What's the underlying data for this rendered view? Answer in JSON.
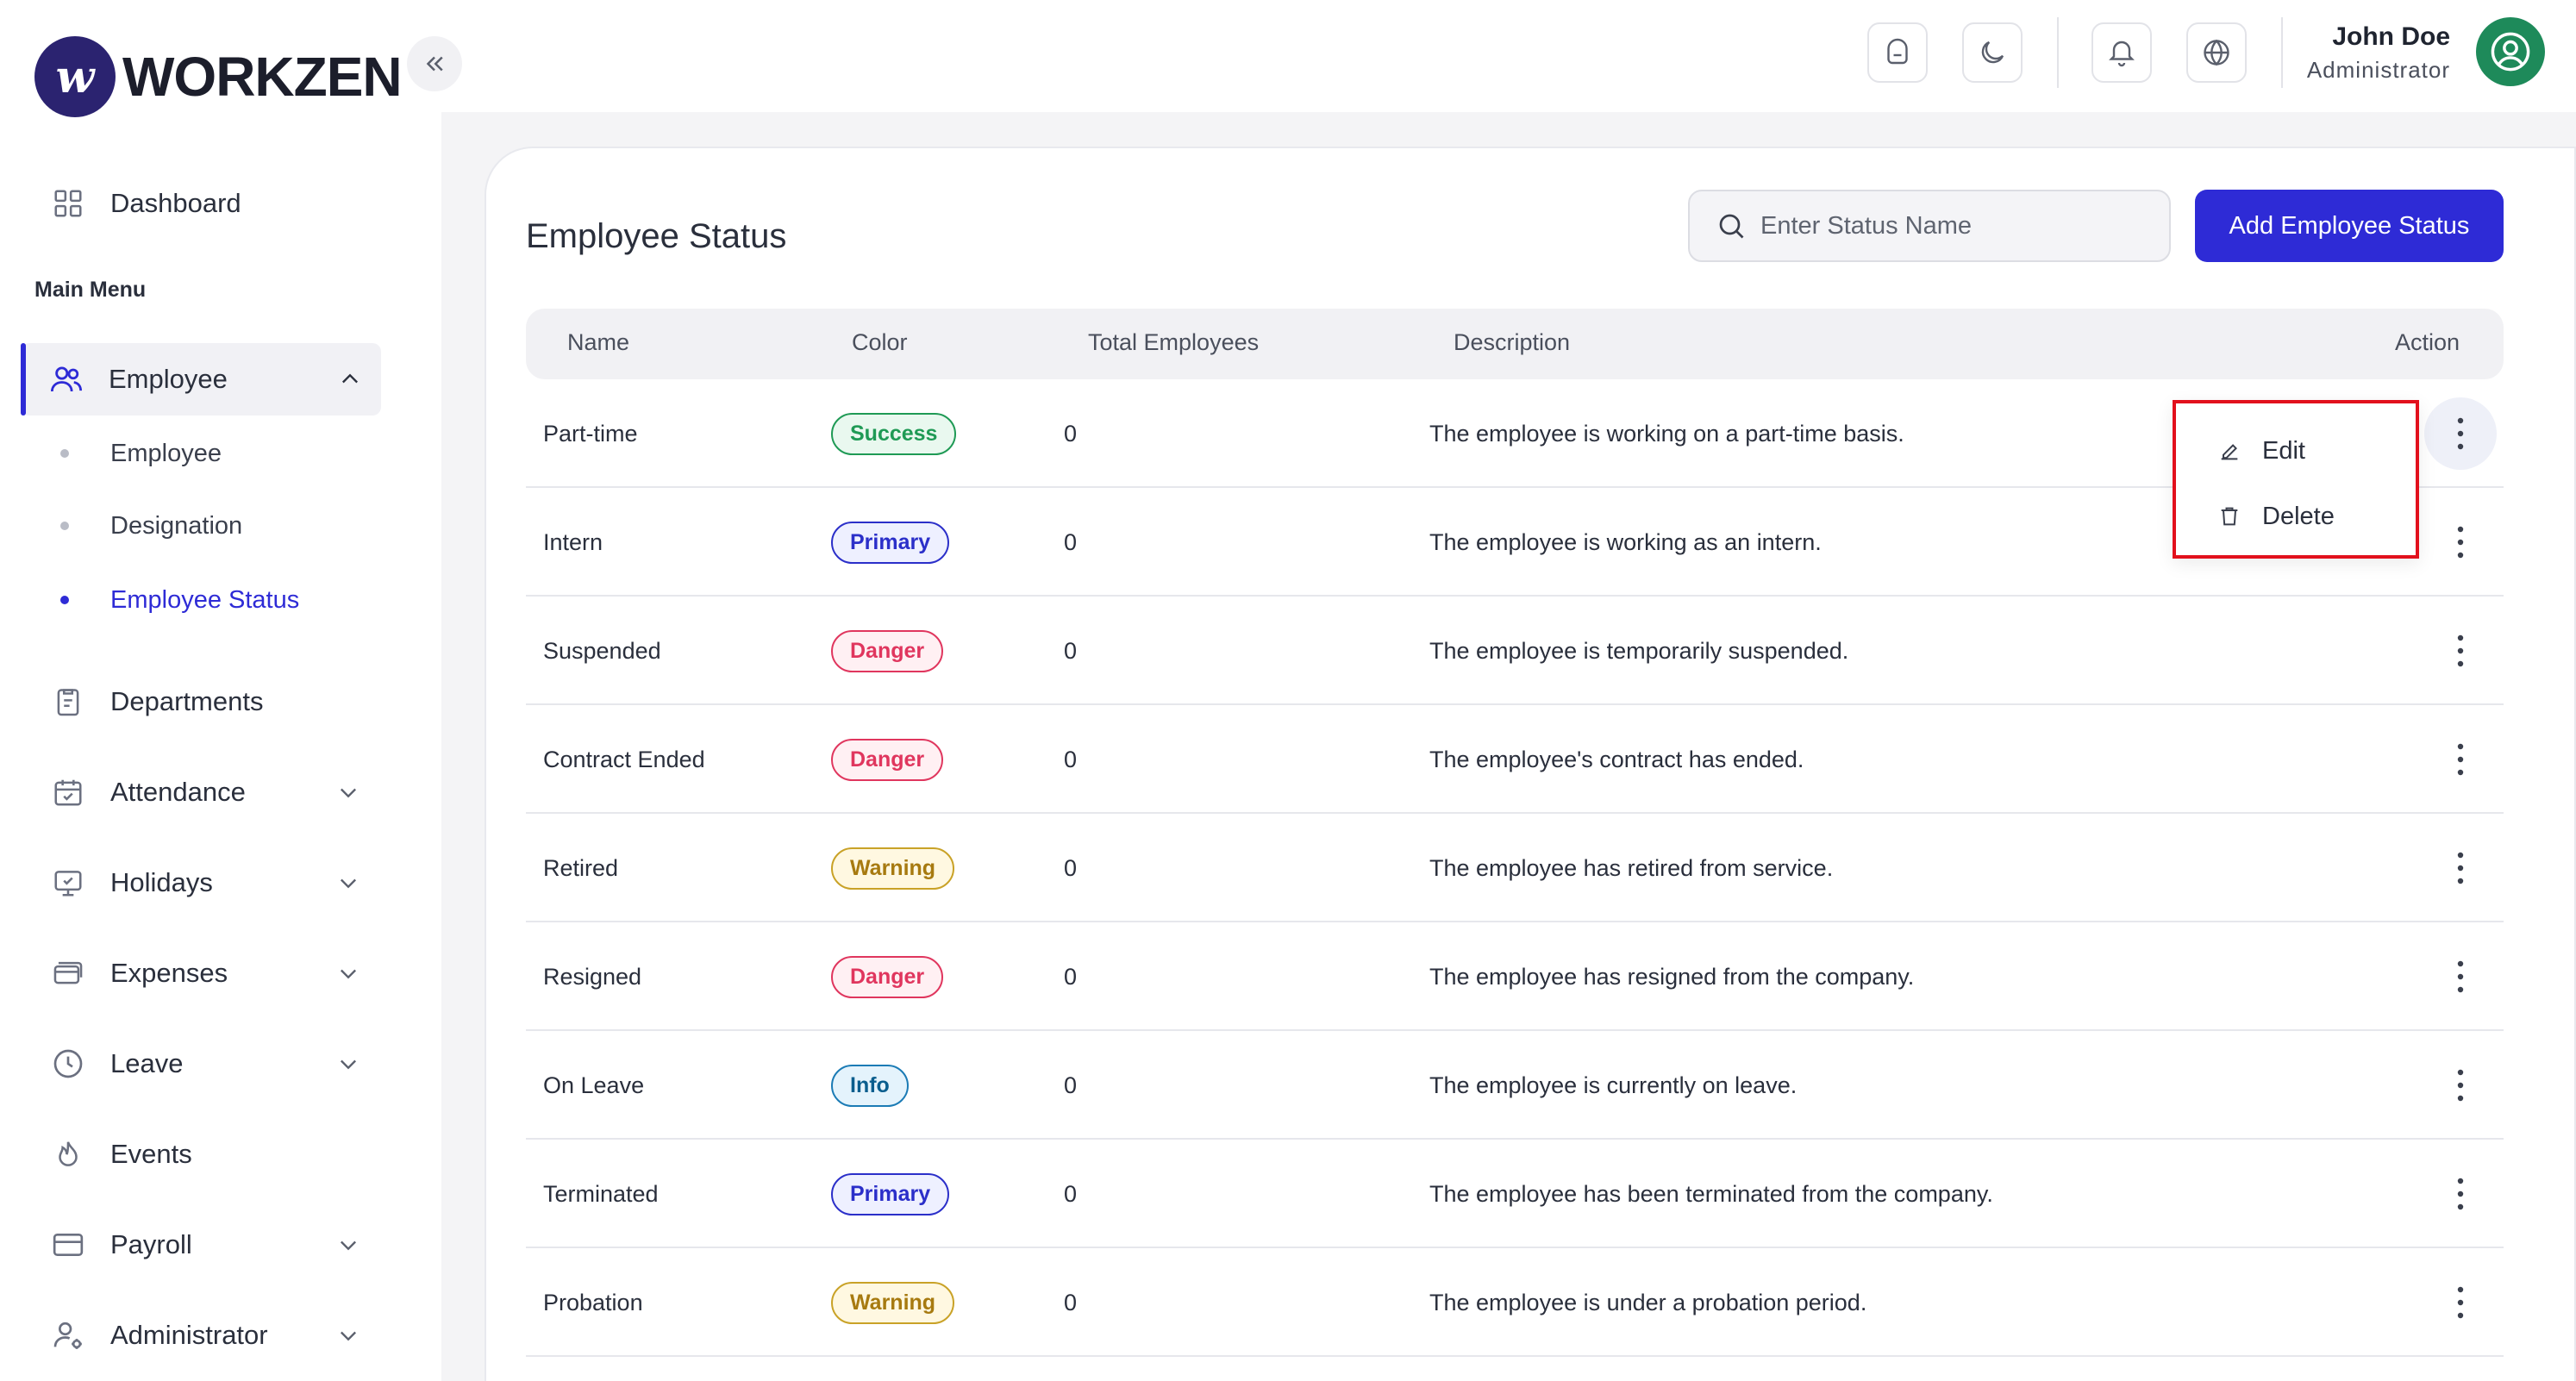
{
  "brand": {
    "logo_letter": "w",
    "name": "WORKZEN"
  },
  "sidebar": {
    "dashboard": "Dashboard",
    "section_label": "Main Menu",
    "employee": "Employee",
    "employee_sub": [
      "Employee",
      "Designation",
      "Employee Status"
    ],
    "items": [
      "Departments",
      "Attendance",
      "Holidays",
      "Expenses",
      "Leave",
      "Events",
      "Payroll",
      "Administrator"
    ]
  },
  "user": {
    "name": "John Doe",
    "role": "Administrator"
  },
  "page": {
    "title": "Employee Status",
    "search_placeholder": "Enter Status Name",
    "add_button": "Add Employee Status"
  },
  "table": {
    "headers": [
      "Name",
      "Color",
      "Total Employees",
      "Description",
      "Action"
    ],
    "rows": [
      {
        "name": "Part-time",
        "color": "Success",
        "total": "0",
        "description": "The employee is working on a part-time basis."
      },
      {
        "name": "Intern",
        "color": "Primary",
        "total": "0",
        "description": "The employee is working as an intern."
      },
      {
        "name": "Suspended",
        "color": "Danger",
        "total": "0",
        "description": "The employee is temporarily suspended."
      },
      {
        "name": "Contract Ended",
        "color": "Danger",
        "total": "0",
        "description": "The employee's contract has ended."
      },
      {
        "name": "Retired",
        "color": "Warning",
        "total": "0",
        "description": "The employee has retired from service."
      },
      {
        "name": "Resigned",
        "color": "Danger",
        "total": "0",
        "description": "The employee has resigned from the company."
      },
      {
        "name": "On Leave",
        "color": "Info",
        "total": "0",
        "description": "The employee is currently on leave."
      },
      {
        "name": "Terminated",
        "color": "Primary",
        "total": "0",
        "description": "The employee has been terminated from the company."
      },
      {
        "name": "Probation",
        "color": "Warning",
        "total": "0",
        "description": "The employee is under a probation period."
      }
    ]
  },
  "badge_colors": {
    "Success": {
      "text": "#1f9a55",
      "border": "#1f9a55",
      "bg": "#e9f8ef"
    },
    "Primary": {
      "text": "#2b2fc9",
      "border": "#2b2fc9",
      "bg": "#eef0ff"
    },
    "Danger": {
      "text": "#e0365e",
      "border": "#e0365e",
      "bg": "#fff0f3"
    },
    "Warning": {
      "text": "#a77a10",
      "border": "#c9a227",
      "bg": "#fff8e1"
    },
    "Info": {
      "text": "#0a5e8e",
      "border": "#1b7bb5",
      "bg": "#e4f3fc"
    }
  },
  "dropdown": {
    "edit": "Edit",
    "delete": "Delete"
  },
  "colors": {
    "accent": "#2e2bd6",
    "highlight_border": "#e2101c"
  }
}
